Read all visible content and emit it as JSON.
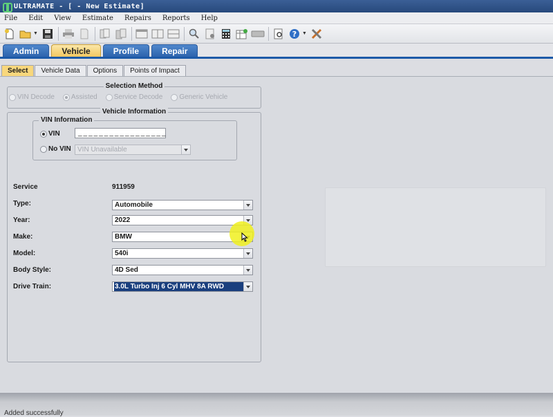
{
  "window": {
    "title": "ULTRAMATE - [ - New Estimate]"
  },
  "menu": [
    "File",
    "Edit",
    "View",
    "Estimate",
    "Repairs",
    "Reports",
    "Help"
  ],
  "main_tabs": [
    {
      "label": "Admin",
      "active": false
    },
    {
      "label": "Vehicle",
      "active": true
    },
    {
      "label": "Profile",
      "active": false
    },
    {
      "label": "Repair",
      "active": false
    }
  ],
  "sub_tabs": [
    {
      "label": "Select",
      "active": true
    },
    {
      "label": "Vehicle Data",
      "active": false
    },
    {
      "label": "Options",
      "active": false
    },
    {
      "label": "Points of Impact",
      "active": false
    }
  ],
  "selection_method": {
    "title": "Selection Method",
    "options": [
      {
        "label": "VIN Decode",
        "checked": false
      },
      {
        "label": "Assisted",
        "checked": true
      },
      {
        "label": "Service Decode",
        "checked": false
      },
      {
        "label": "Generic Vehicle",
        "checked": false
      }
    ]
  },
  "vehicle_info": {
    "title": "Vehicle Information",
    "vin_info_title": "VIN Information",
    "vin_label": "VIN",
    "vin_value": "_________________",
    "no_vin_label": "No VIN",
    "no_vin_value": "VIN Unavailable",
    "service_label": "Service",
    "service_value": "911959",
    "fields": [
      {
        "label": "Type:",
        "value": "Automobile"
      },
      {
        "label": "Year:",
        "value": "2022"
      },
      {
        "label": "Make:",
        "value": "BMW"
      },
      {
        "label": "Model:",
        "value": "540i"
      },
      {
        "label": "Body Style:",
        "value": "4D Sed"
      },
      {
        "label": "Drive Train:",
        "value": "3.0L Turbo Inj 6 Cyl MHV 8A RWD"
      }
    ]
  },
  "status": {
    "text": "Added successfully"
  },
  "colors": {
    "title_bar": "#27497c",
    "tab_blue": "#2d64ad",
    "tab_active": "#f2c861",
    "selection_highlight": "#1a3f7e"
  }
}
